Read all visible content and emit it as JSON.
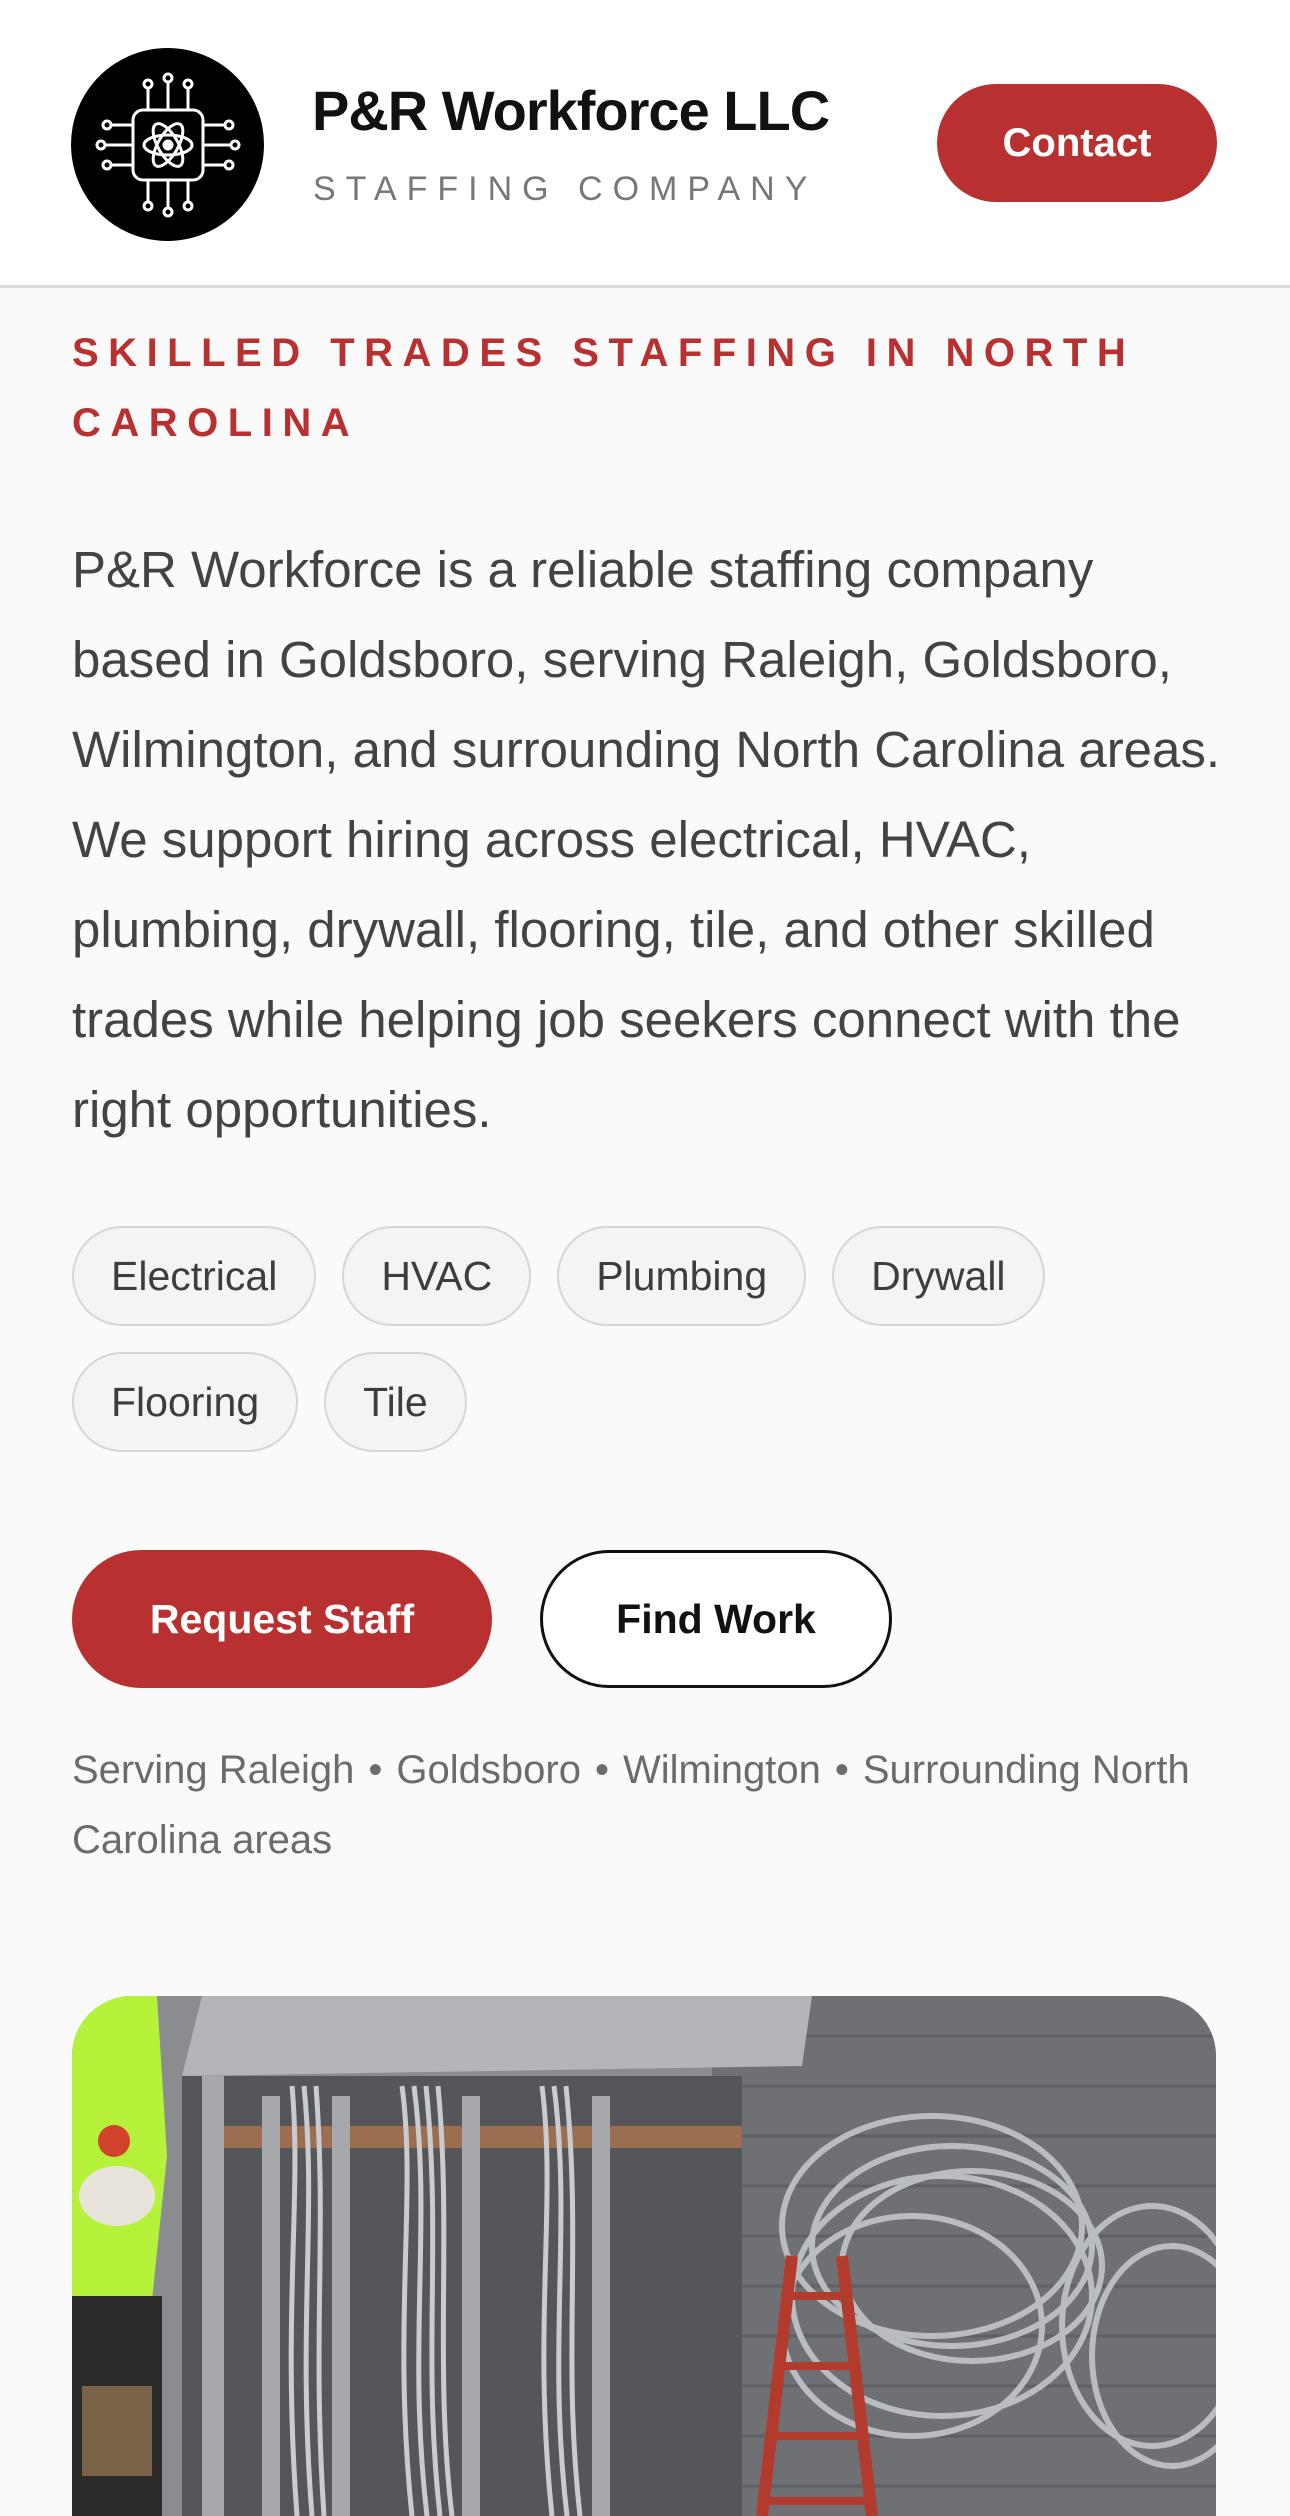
{
  "header": {
    "brand_name": "P&R Workforce LLC",
    "brand_subtitle": "STAFFING COMPANY",
    "contact_label": "Contact"
  },
  "hero": {
    "eyebrow": "SKILLED TRADES STAFFING IN NORTH CAROLINA",
    "lead": "P&R Workforce is a reliable staffing company based in Goldsboro, serving Raleigh, Goldsboro, Wilmington, and surrounding North Carolina areas. We support hiring across electrical, HVAC, plumbing, drywall, flooring, tile, and other skilled trades while helping job seekers connect with the right opportunities.",
    "trades": [
      "Electrical",
      "HVAC",
      "Plumbing",
      "Drywall",
      "Flooring",
      "Tile"
    ],
    "request_staff_label": "Request Staff",
    "find_work_label": "Find Work",
    "service_areas": [
      "Serving Raleigh",
      "Goldsboro",
      "Wilmington",
      "Surrounding North Carolina areas"
    ]
  },
  "colors": {
    "accent": "#b83130",
    "text": "#434343",
    "muted": "#6b6b6b"
  },
  "icons": {
    "logo": "atom-circuit-icon"
  }
}
